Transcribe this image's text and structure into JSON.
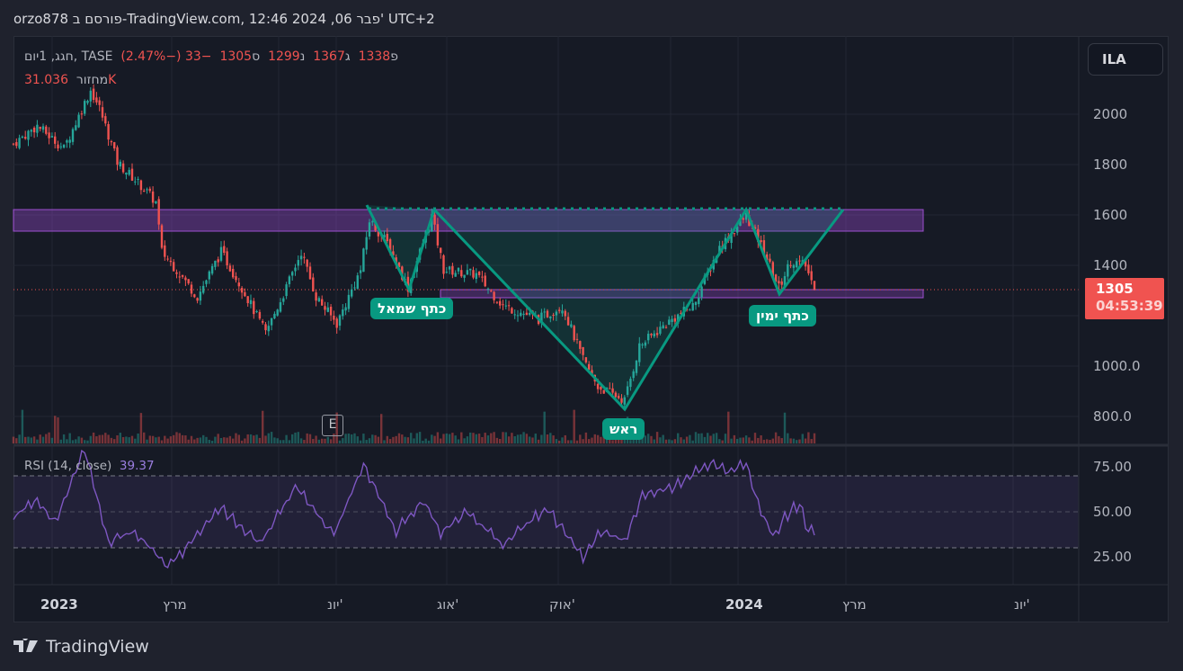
{
  "header": {
    "title": "orzo878 פורסם ב-TradingView.com, 12:46 2024 ,06 פבר' UTC+2"
  },
  "legend": {
    "symbol": "חגג, 1יום, TASE",
    "open_prefix": "פ",
    "open": "1338",
    "high_prefix": "ג",
    "high": "1367",
    "low_prefix": "נ",
    "low": "1299",
    "close_prefix": "ס",
    "close": "1305",
    "change": "−33 (−2.47%)",
    "volume_label": "מחזור",
    "volume": "31.036K"
  },
  "price_scale": {
    "currency": "ILA",
    "ticks": [
      "2000",
      "1800",
      "1600",
      "1400",
      "1000.0",
      "800.0"
    ],
    "last_price": "1305",
    "countdown": "04:53:39"
  },
  "rsi": {
    "label": "RSI (14, close)",
    "value": "39.37",
    "ticks": [
      "75.00",
      "50.00",
      "25.00"
    ]
  },
  "time_axis": {
    "ticks": [
      "2023",
      "מרץ",
      "יונ'",
      "אוג'",
      "אוק'",
      "2024",
      "מרץ",
      "יונ'"
    ]
  },
  "annotations": {
    "left_shoulder": "כתף שמאל",
    "head": "ראש",
    "right_shoulder": "כתף ימין",
    "earnings": "E"
  },
  "footer": {
    "brand": "TradingView"
  },
  "colors": {
    "up": "#26a69a",
    "down": "#f05350",
    "pattern": "#089981",
    "zone": "#7b3fa0",
    "rsi": "#7e57c2"
  },
  "chart_data": {
    "type": "candlestick",
    "title": "חגג, 1יום, TASE",
    "ylabel": "ILA",
    "ylim": [
      700,
      2260
    ],
    "price_path": [
      [
        0,
        1882
      ],
      [
        8,
        1954
      ],
      [
        17,
        1864
      ],
      [
        26,
        2096
      ],
      [
        29,
        2025
      ],
      [
        35,
        1810
      ],
      [
        44,
        1704
      ],
      [
        48,
        1650
      ],
      [
        50,
        1454
      ],
      [
        55,
        1382
      ],
      [
        62,
        1275
      ],
      [
        70,
        1454
      ],
      [
        77,
        1311
      ],
      [
        85,
        1132
      ],
      [
        92,
        1311
      ],
      [
        97,
        1454
      ],
      [
        102,
        1275
      ],
      [
        109,
        1168
      ],
      [
        117,
        1382
      ],
      [
        120,
        1579
      ],
      [
        126,
        1489
      ],
      [
        133,
        1311
      ],
      [
        141,
        1596
      ],
      [
        145,
        1382
      ],
      [
        156,
        1364
      ],
      [
        165,
        1239
      ],
      [
        177,
        1186
      ],
      [
        185,
        1239
      ],
      [
        192,
        1025
      ],
      [
        197,
        918
      ],
      [
        206,
        864
      ],
      [
        211,
        1079
      ],
      [
        220,
        1168
      ],
      [
        229,
        1239
      ],
      [
        238,
        1471
      ],
      [
        247,
        1596
      ],
      [
        253,
        1454
      ],
      [
        258,
        1311
      ],
      [
        262,
        1418
      ],
      [
        267,
        1400
      ],
      [
        270,
        1305
      ]
    ],
    "rsi_path": [
      [
        0,
        47
      ],
      [
        8,
        57
      ],
      [
        14,
        44
      ],
      [
        24,
        84
      ],
      [
        32,
        34
      ],
      [
        41,
        39
      ],
      [
        52,
        19
      ],
      [
        59,
        32
      ],
      [
        70,
        52
      ],
      [
        83,
        32
      ],
      [
        95,
        64
      ],
      [
        108,
        37
      ],
      [
        118,
        77
      ],
      [
        129,
        39
      ],
      [
        138,
        57
      ],
      [
        144,
        39
      ],
      [
        153,
        49
      ],
      [
        165,
        32
      ],
      [
        180,
        52
      ],
      [
        192,
        24
      ],
      [
        198,
        39
      ],
      [
        206,
        34
      ],
      [
        212,
        60
      ],
      [
        223,
        64
      ],
      [
        235,
        77
      ],
      [
        241,
        72
      ],
      [
        247,
        77
      ],
      [
        251,
        54
      ],
      [
        256,
        37
      ],
      [
        261,
        49
      ],
      [
        265,
        54
      ],
      [
        268,
        39
      ],
      [
        270,
        39
      ]
    ],
    "rsi_ylim": [
      0,
      100
    ],
    "rsi_bands": [
      30,
      50,
      70
    ],
    "resistance_zone": [
      1546,
      1632
    ],
    "support_zone": [
      1295,
      1320
    ],
    "neckline": 1620,
    "pattern": "head-and-shoulders (inverse)"
  }
}
